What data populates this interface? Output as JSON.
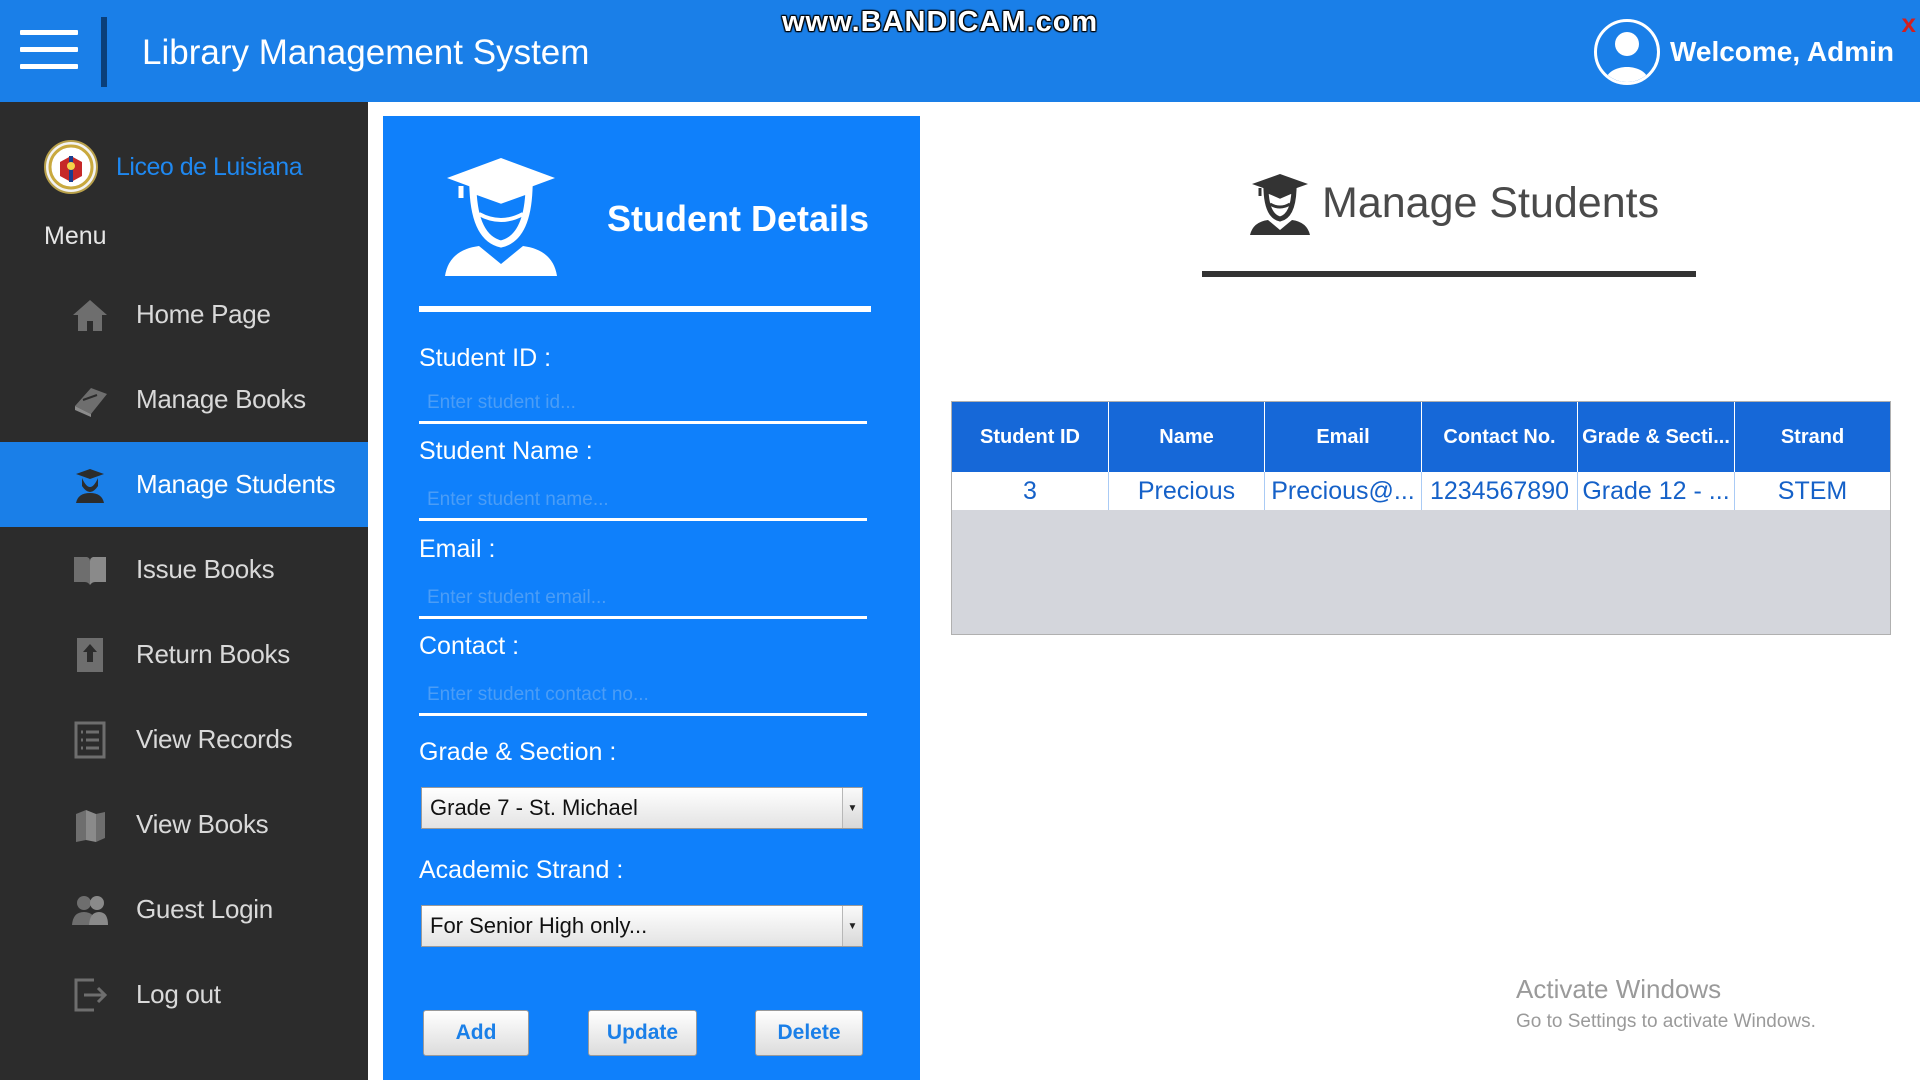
{
  "header": {
    "menu_icon": "hamburger-icon",
    "app_title": "Library Management System",
    "watermark": "www.BANDICAM.com",
    "welcome": "Welcome, Admin",
    "close": "x"
  },
  "sidebar": {
    "school_name": "Liceo de Luisiana",
    "menu_label": "Menu",
    "items": [
      {
        "label": "Home Page",
        "icon": "home-icon",
        "active": false
      },
      {
        "label": "Manage Books",
        "icon": "book-icon",
        "active": false
      },
      {
        "label": "Manage Students",
        "icon": "student-icon",
        "active": true
      },
      {
        "label": "Issue Books",
        "icon": "open-book-icon",
        "active": false
      },
      {
        "label": "Return Books",
        "icon": "return-icon",
        "active": false
      },
      {
        "label": "View Records",
        "icon": "list-icon",
        "active": false
      },
      {
        "label": "View Books",
        "icon": "books-icon",
        "active": false
      },
      {
        "label": "Guest Login",
        "icon": "users-icon",
        "active": false
      },
      {
        "label": "Log out",
        "icon": "logout-icon",
        "active": false
      }
    ]
  },
  "form": {
    "title": "Student Details",
    "student_id": {
      "label": "Student ID :",
      "placeholder": "Enter student id...",
      "value": ""
    },
    "student_name": {
      "label": "Student Name :",
      "placeholder": "Enter student name...",
      "value": ""
    },
    "email": {
      "label": "Email :",
      "placeholder": "Enter student email...",
      "value": ""
    },
    "contact": {
      "label": "Contact :",
      "placeholder": "Enter student contact no...",
      "value": ""
    },
    "grade_section": {
      "label": "Grade & Section :",
      "selected": "Grade 7 - St. Michael"
    },
    "strand": {
      "label": "Academic Strand :",
      "selected": "For Senior High only..."
    },
    "buttons": {
      "add": "Add",
      "update": "Update",
      "delete": "Delete"
    }
  },
  "main": {
    "title": "Manage Students",
    "table": {
      "columns": [
        "Student ID",
        "Name",
        "Email",
        "Contact No.",
        "Grade & Secti...",
        "Strand"
      ],
      "rows": [
        [
          "3",
          "Precious",
          "Precious@...",
          "1234567890",
          "Grade 12 - ...",
          "STEM"
        ]
      ]
    }
  },
  "activation": {
    "line1": "Activate Windows",
    "line2": "Go to Settings to activate Windows."
  },
  "colors": {
    "header_blue": "#1A7FE8",
    "panel_blue": "#0F80FB",
    "sidebar_dark": "#2c2c2c",
    "table_header": "#1668d8"
  }
}
